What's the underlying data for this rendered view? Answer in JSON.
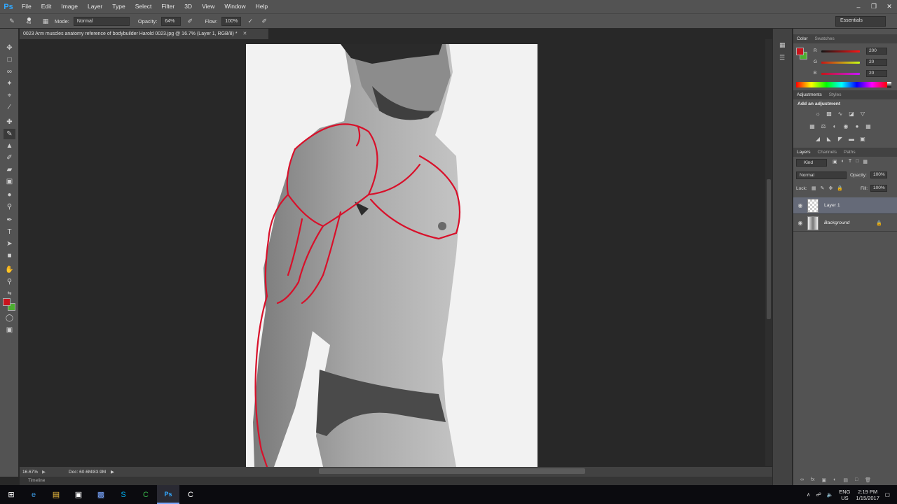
{
  "app": {
    "logo": "Ps",
    "menu": [
      "File",
      "Edit",
      "Image",
      "Layer",
      "Type",
      "Select",
      "Filter",
      "3D",
      "View",
      "Window",
      "Help"
    ]
  },
  "options": {
    "brush_size": "46",
    "mode_label": "Mode:",
    "mode_value": "Normal",
    "opacity_label": "Opacity:",
    "opacity_value": "64%",
    "flow_label": "Flow:",
    "flow_value": "100%",
    "workspace": "Essentials"
  },
  "document": {
    "tab_title": "0023 Arm muscles anatomy reference of bodybuilder Harold 0023.jpg @ 16.7% (Layer 1, RGB/8) *",
    "zoom": "16.67%",
    "doc_size": "Doc: 60.6M/83.9M",
    "timeline": "Timeline"
  },
  "colors": {
    "foreground": "#c8141d",
    "background": "#4caf30"
  },
  "color_panel": {
    "tabs": [
      "Color",
      "Swatches"
    ],
    "r_label": "R",
    "g_label": "G",
    "b_label": "B",
    "r": "200",
    "g": "20",
    "b": "20"
  },
  "adjustments_panel": {
    "tabs": [
      "Adjustments",
      "Styles"
    ],
    "heading": "Add an adjustment"
  },
  "layers_panel": {
    "tabs": [
      "Layers",
      "Channels",
      "Paths"
    ],
    "kind_label": "Kind",
    "blend_mode": "Normal",
    "opacity_label": "Opacity:",
    "opacity_value": "100%",
    "lock_label": "Lock:",
    "fill_label": "Fill:",
    "fill_value": "100%",
    "layers": [
      {
        "name": "Layer 1"
      },
      {
        "name": "Background"
      }
    ]
  },
  "taskbar": {
    "lang": "ENG",
    "lang_region": "US",
    "time": "2:19 PM",
    "date": "1/15/2017"
  }
}
